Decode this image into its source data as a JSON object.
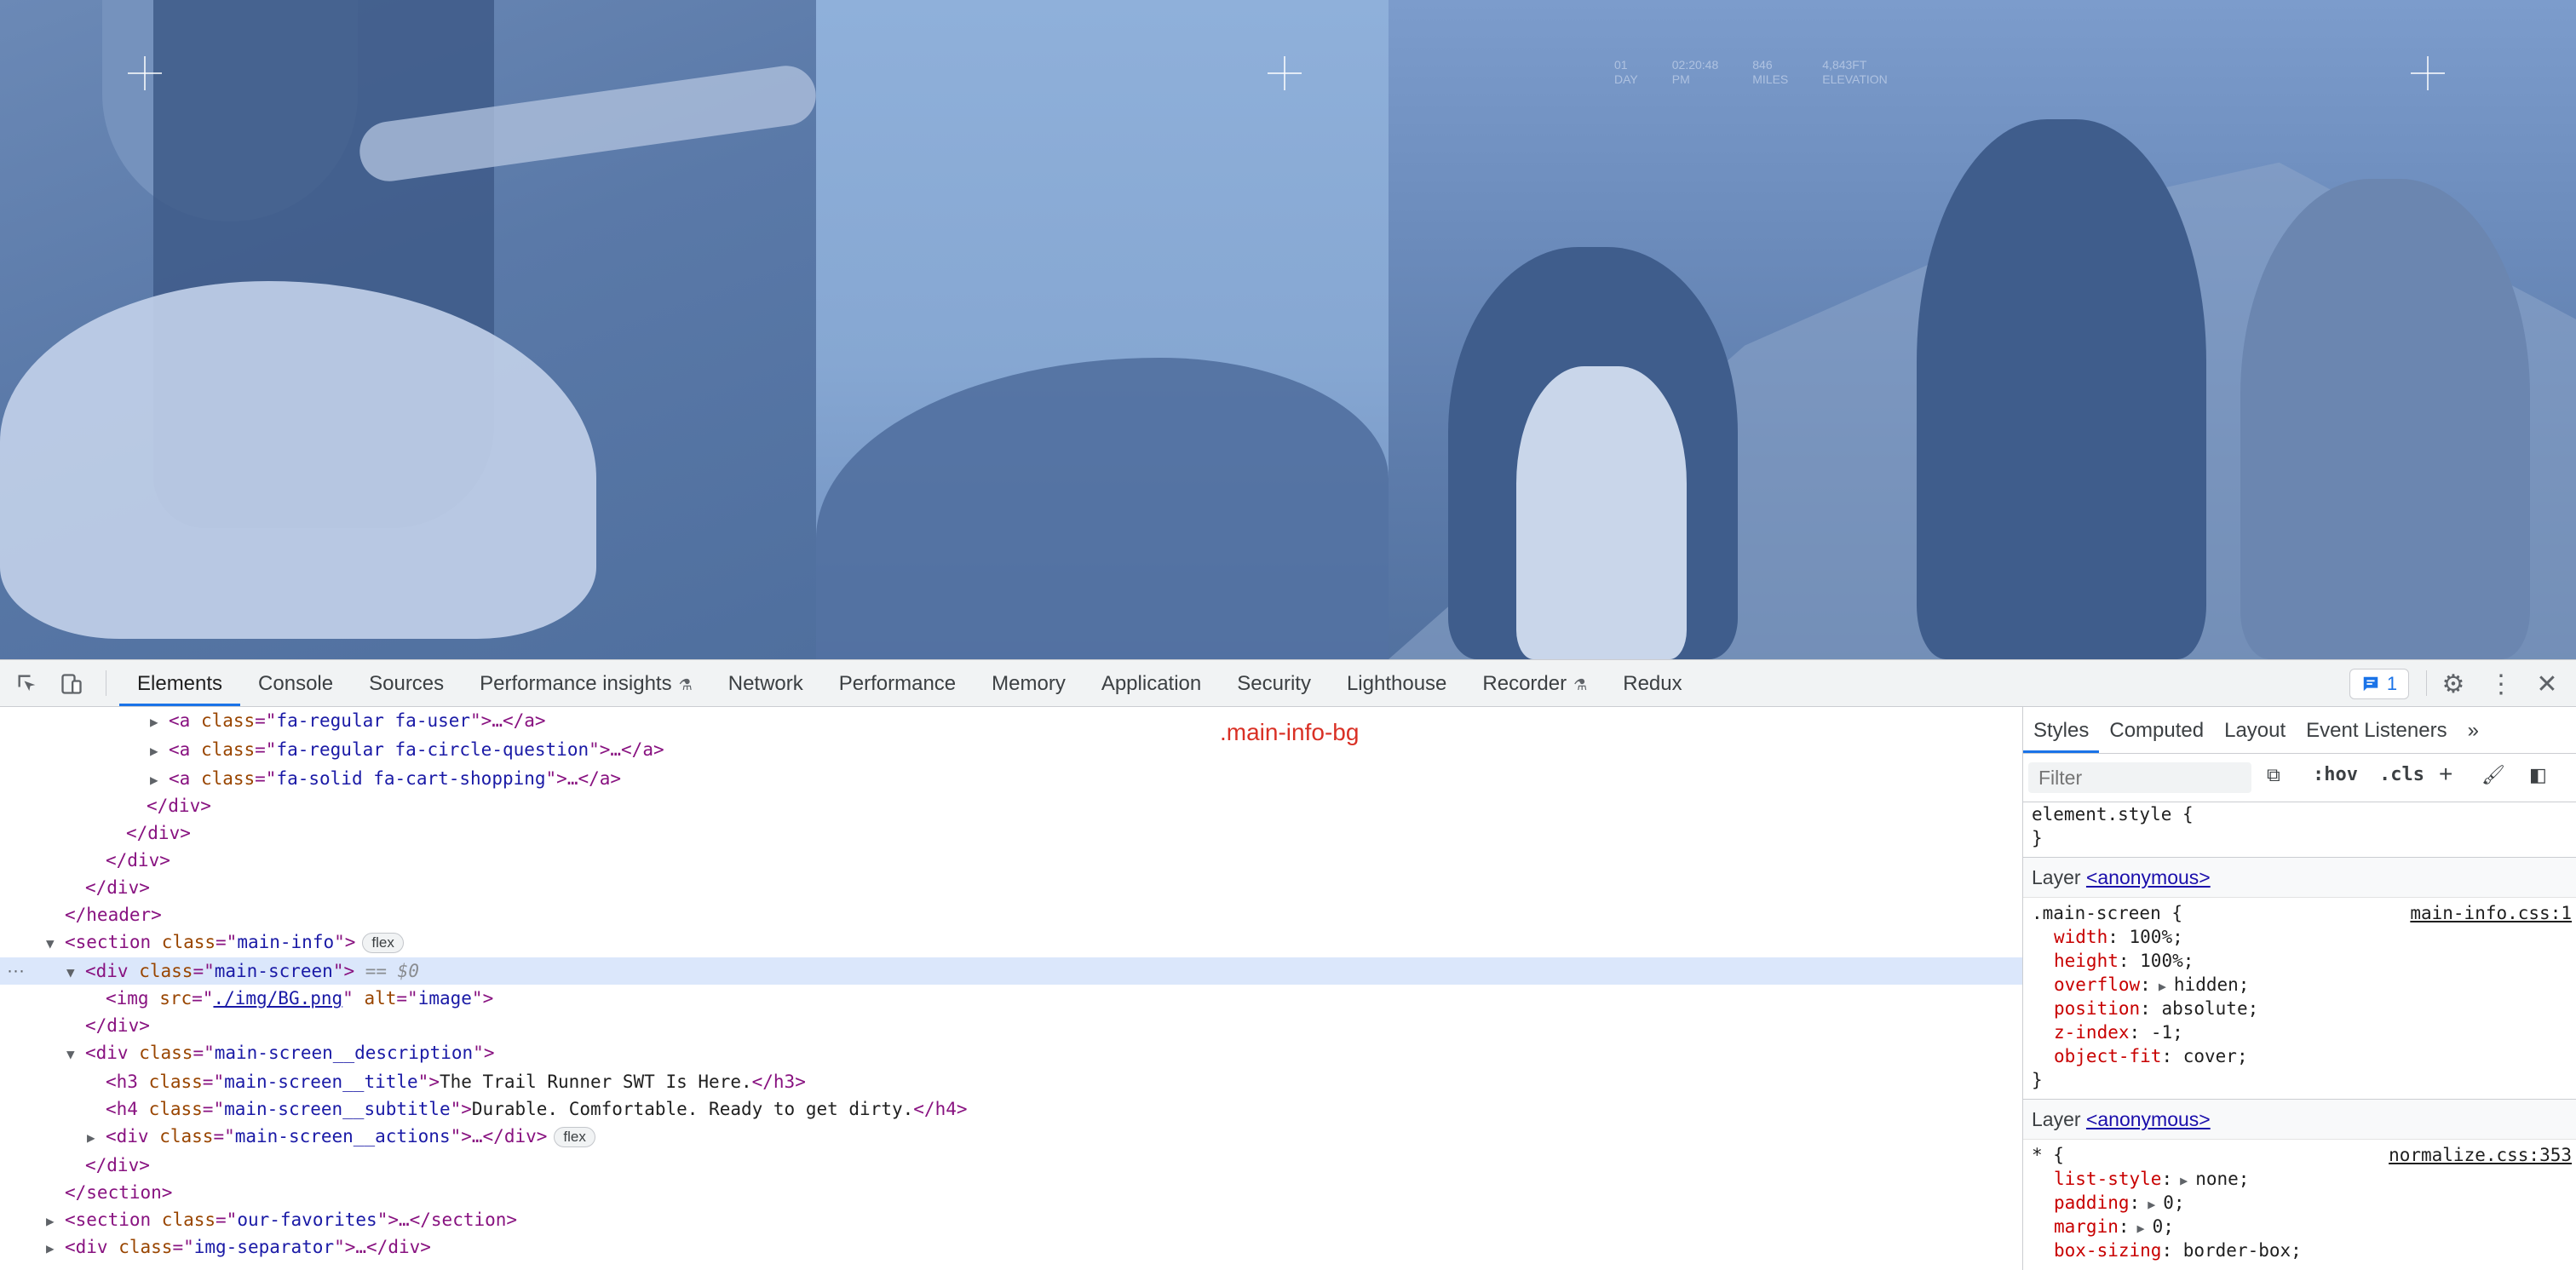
{
  "hero": {
    "stats": [
      {
        "value": "01",
        "label": "DAY"
      },
      {
        "value": "02:20:48",
        "label": "PM"
      },
      {
        "value": "846",
        "label": "MILES"
      },
      {
        "value": "4,843FT",
        "label": "ELEVATION"
      }
    ]
  },
  "devtools": {
    "tabs": [
      "Elements",
      "Console",
      "Sources",
      "Performance insights",
      "Network",
      "Performance",
      "Memory",
      "Application",
      "Security",
      "Lighthouse",
      "Recorder",
      "Redux"
    ],
    "active_tab": "Elements",
    "issues_count": "1",
    "overlay_label": ".main-info-bg",
    "dom": {
      "l1": {
        "cls": "fa-regular fa-user"
      },
      "l2": {
        "cls": "fa-regular fa-circle-question"
      },
      "l3": {
        "cls": "fa-solid fa-cart-shopping"
      },
      "section_main_info": "main-info",
      "flex_badge": "flex",
      "main_screen": "main-screen",
      "eq": "== $0",
      "img_src": "./img/BG.png",
      "img_alt": "image",
      "desc_cls": "main-screen__description",
      "title_cls": "main-screen__title",
      "title_text": "The Trail Runner SWT Is Here.",
      "subtitle_cls": "main-screen__subtitle",
      "subtitle_text": "Durable. Comfortable. Ready to get dirty.",
      "actions_cls": "main-screen__actions",
      "favorites_cls": "our-favorites",
      "separator_cls": "img-separator"
    }
  },
  "styles": {
    "tabs": [
      "Styles",
      "Computed",
      "Layout",
      "Event Listeners"
    ],
    "filter_placeholder": "Filter",
    "hov": ":hov",
    "cls": ".cls",
    "element_style": "element.style {",
    "close_brace": "}",
    "layer_label": "Layer",
    "layer_link": "<anonymous>",
    "rule1": {
      "selector": ".main-screen {",
      "source": "main-info.css:1",
      "props": [
        {
          "name": "width",
          "value": "100%;"
        },
        {
          "name": "height",
          "value": "100%;"
        },
        {
          "name": "overflow",
          "value": "hidden;"
        },
        {
          "name": "position",
          "value": "absolute;"
        },
        {
          "name": "z-index",
          "value": "-1;"
        },
        {
          "name": "object-fit",
          "value": "cover;"
        }
      ]
    },
    "rule2": {
      "selector": "* {",
      "source": "normalize.css:353",
      "props": [
        {
          "name": "list-style",
          "value": "none;"
        },
        {
          "name": "padding",
          "value": "0;"
        },
        {
          "name": "margin",
          "value": "0;"
        },
        {
          "name": "box-sizing",
          "value": "border-box;"
        }
      ]
    }
  }
}
